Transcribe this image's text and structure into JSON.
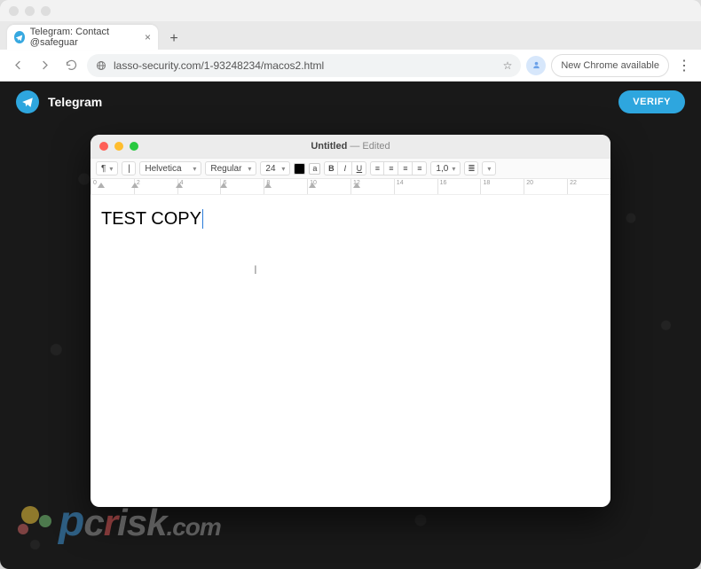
{
  "browser": {
    "tab_title": "Telegram: Contact @safeguar",
    "url": "lasso-security.com/1-93248234/macos2.html",
    "new_chrome": "New Chrome available"
  },
  "page": {
    "app_name": "Telegram",
    "verify": "VERIFY"
  },
  "editor": {
    "title": "Untitled",
    "edited": "— Edited",
    "font_family": "Helvetica",
    "font_style": "Regular",
    "font_size": "24",
    "line_spacing": "1,0",
    "btn_bold": "B",
    "btn_italic": "I",
    "btn_underline": "U",
    "ruler_ticks": [
      "0",
      "2",
      "4",
      "6",
      "8",
      "10",
      "12",
      "14",
      "16",
      "18",
      "20",
      "22"
    ],
    "body": "TEST COPY"
  },
  "wm": {
    "p": "p",
    "c": "c",
    "r": "r",
    "isk": "isk",
    "ext": ".com"
  }
}
